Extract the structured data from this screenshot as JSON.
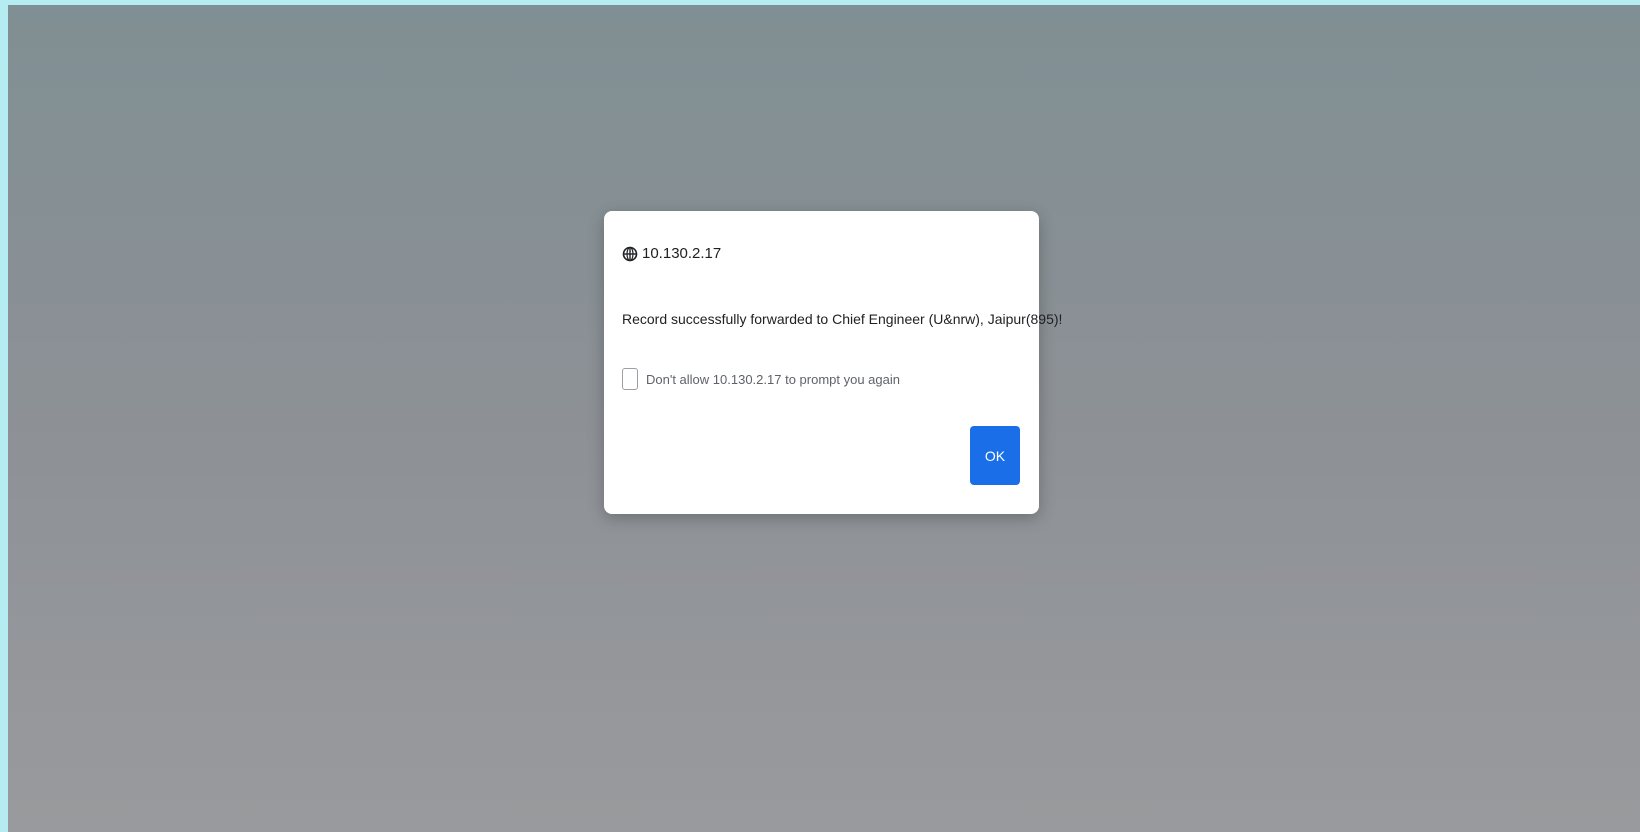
{
  "dialog": {
    "origin": "10.130.2.17",
    "origin_icon": "globe-icon",
    "message": "Record successfully forwarded to Chief Engineer (U&nrw), Jaipur(895)!",
    "suppress_label": "Don't allow 10.130.2.17 to prompt you again",
    "suppress_checked": false,
    "ok_label": "OK"
  },
  "colors": {
    "frame_border": "#b4ecf2",
    "ok_button": "#1a6fe8",
    "dialog_background": "#ffffff"
  }
}
